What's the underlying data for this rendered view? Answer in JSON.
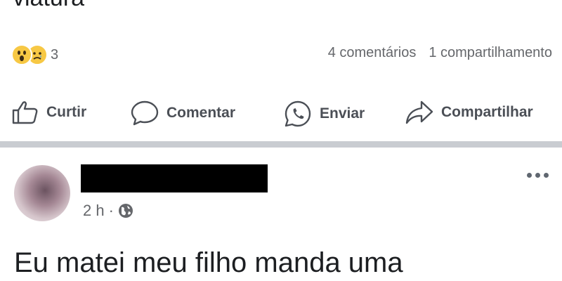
{
  "previous_post": {
    "text_fragment": "viatura",
    "reactions": {
      "icons": [
        "wow-reaction",
        "sad-reaction"
      ],
      "count": "3"
    },
    "comments_label": "4 comentários",
    "shares_label": "1 compartilhamento",
    "actions": {
      "like_label": "Curtir",
      "comment_label": "Comentar",
      "send_label": "Enviar",
      "share_label": "Compartilhar"
    }
  },
  "next_post": {
    "author_redacted": true,
    "time": "2 h",
    "separator": "·",
    "privacy_icon": "globe-icon",
    "text": "Eu matei meu filho manda uma"
  },
  "colors": {
    "text": "#1c1e21",
    "secondary_text": "#65676b",
    "action_text": "#4b4f56",
    "divider": "#c9ccd1",
    "reaction_yellow": "#f7c844"
  }
}
